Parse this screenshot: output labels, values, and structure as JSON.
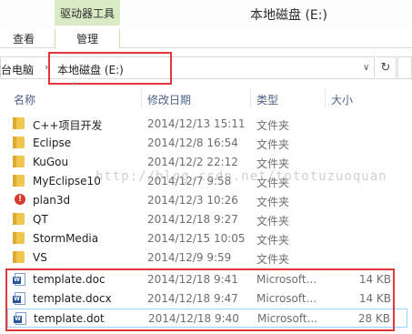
{
  "titlebar": {
    "context_tab": "驱动器工具",
    "title": "本地磁盘 (E:)"
  },
  "ribbon": {
    "tabs": [
      "查看",
      "管理"
    ]
  },
  "address": {
    "crumb_this_pc": "这台电脑",
    "separator": "›",
    "crumb_current": "本地磁盘 (E:)",
    "dropdown": "∨",
    "refresh": "↻"
  },
  "columns": {
    "name": "名称",
    "date": "修改日期",
    "type": "类型",
    "size": "大小",
    "sort_arrow": "^"
  },
  "files": [
    {
      "name": "C++项目开发",
      "date": "2014/12/13 15:11",
      "type": "文件夹",
      "size": "",
      "icon": "folder-icon"
    },
    {
      "name": "Eclipse",
      "date": "2014/12/8 16:54",
      "type": "文件夹",
      "size": "",
      "icon": "folder-icon"
    },
    {
      "name": "KuGou",
      "date": "2014/12/2 22:12",
      "type": "文件夹",
      "size": "",
      "icon": "folder-icon"
    },
    {
      "name": "MyEclipse10",
      "date": "2014/12/7 9:58",
      "type": "文件夹",
      "size": "",
      "icon": "folder-icon"
    },
    {
      "name": "plan3d",
      "date": "2014/12/3 10:26",
      "type": "文件夹",
      "size": "",
      "icon": "warning-folder-icon"
    },
    {
      "name": "QT",
      "date": "2014/12/18 9:27",
      "type": "文件夹",
      "size": "",
      "icon": "folder-icon"
    },
    {
      "name": "StormMedia",
      "date": "2014/12/15 10:05",
      "type": "文件夹",
      "size": "",
      "icon": "folder-icon"
    },
    {
      "name": "VS",
      "date": "2014/12/9 9:59",
      "type": "文件夹",
      "size": "",
      "icon": "folder-icon"
    },
    {
      "name": "template.doc",
      "date": "2014/12/18 9:41",
      "type": "Microsoft...",
      "size": "14 KB",
      "icon": "word-document-icon"
    },
    {
      "name": "template.docx",
      "date": "2014/12/18 9:47",
      "type": "Microsoft...",
      "size": "14 KB",
      "icon": "word-document-icon"
    },
    {
      "name": "template.dot",
      "date": "2014/12/18 9:40",
      "type": "Microsoft...",
      "size": "28 KB",
      "icon": "word-document-icon"
    }
  ],
  "watermark": "http://blog.csdn.net/tototuzuoquan",
  "colors": {
    "highlight_border": "#e2363a",
    "selection_border": "#99d1ff",
    "context_tab_bg": "#d8ebc5",
    "header_text": "#4d6185"
  }
}
